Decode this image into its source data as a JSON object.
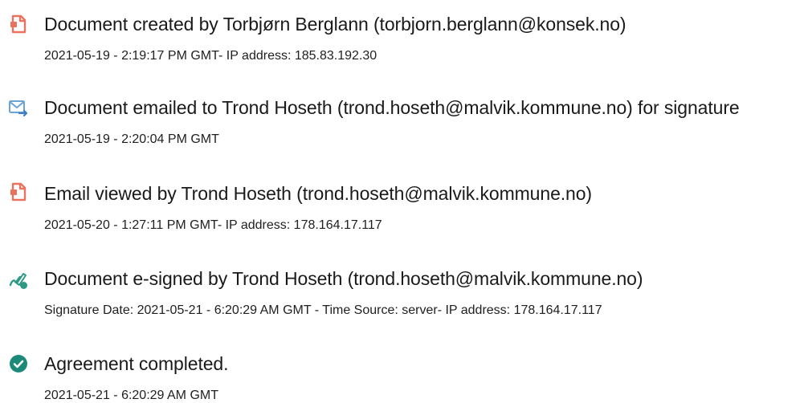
{
  "events": [
    {
      "icon": "document-created-icon",
      "title": "Document created by Torbjørn Berglann (torbjorn.berglann@konsek.no)",
      "detail": "2021-05-19 - 2:19:17 PM GMT- IP address: 185.83.192.30"
    },
    {
      "icon": "email-sent-icon",
      "title": "Document emailed to Trond Hoseth (trond.hoseth@malvik.kommune.no) for signature",
      "detail": "2021-05-19 - 2:20:04 PM GMT"
    },
    {
      "icon": "email-viewed-icon",
      "title": "Email viewed by Trond Hoseth (trond.hoseth@malvik.kommune.no)",
      "detail": "2021-05-20 - 1:27:11 PM GMT- IP address: 178.164.17.117"
    },
    {
      "icon": "e-signed-icon",
      "title": "Document e-signed by Trond Hoseth (trond.hoseth@malvik.kommune.no)",
      "detail": "Signature Date: 2021-05-21 - 6:20:29 AM GMT - Time Source: server- IP address: 178.164.17.117"
    },
    {
      "icon": "agreement-completed-icon",
      "title": "Agreement completed.",
      "detail": "2021-05-21 - 6:20:29 AM GMT"
    }
  ],
  "colors": {
    "document_icon": "#e8735f",
    "email_icon": "#6aa3d8",
    "signed_icon": "#2e9a86",
    "completed_icon": "#1c8a78"
  }
}
